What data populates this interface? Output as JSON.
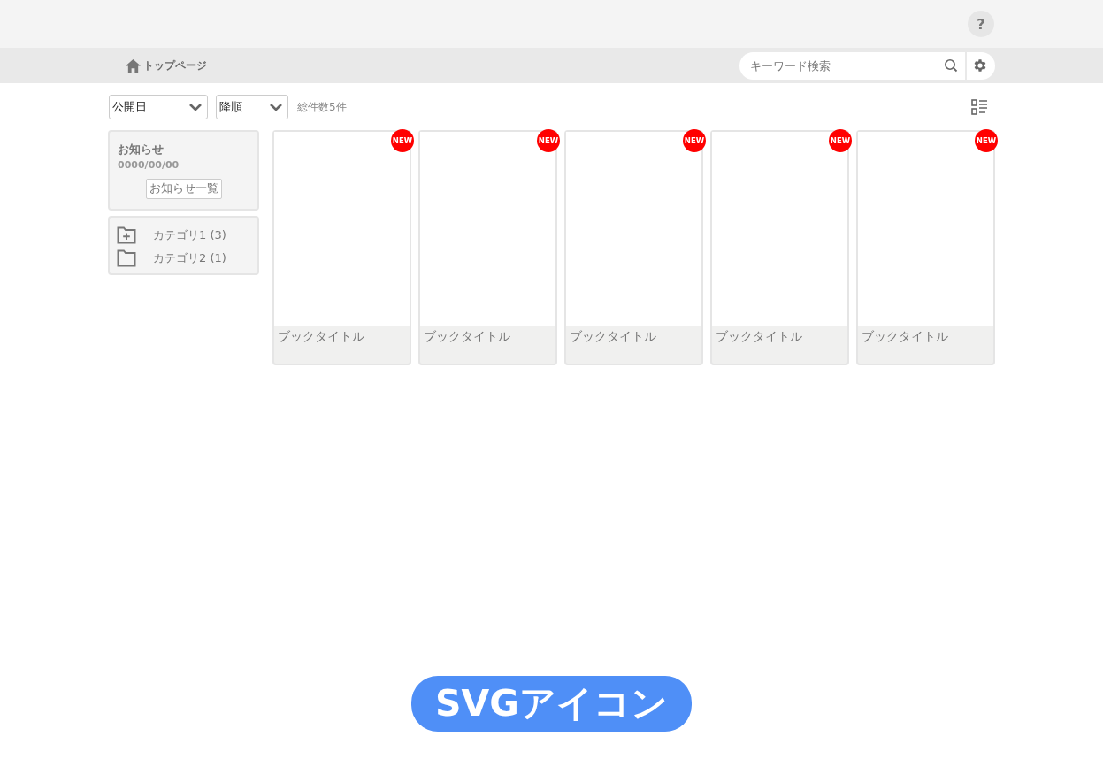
{
  "header": {
    "help": "?"
  },
  "nav": {
    "home": "トップページ",
    "search": {
      "placeholder": "キーワード検索"
    }
  },
  "toolbar": {
    "sort_field": "公開日",
    "sort_order": "降順",
    "total": "総件数5件"
  },
  "notice": {
    "title": "お知らせ",
    "date": "0000/00/00",
    "button": "お知らせ一覧"
  },
  "categories": [
    {
      "label": "カテゴリ1 (3)",
      "kind": "expandable"
    },
    {
      "label": "カテゴリ2 (1)",
      "kind": "plain"
    }
  ],
  "books": [
    {
      "title": "ブックタイトル",
      "badge": "NEW"
    },
    {
      "title": "ブックタイトル",
      "badge": "NEW"
    },
    {
      "title": "ブックタイトル",
      "badge": "NEW"
    },
    {
      "title": "ブックタイトル",
      "badge": "NEW"
    },
    {
      "title": "ブックタイトル",
      "badge": "NEW"
    }
  ],
  "caption": "SVGアイコン"
}
